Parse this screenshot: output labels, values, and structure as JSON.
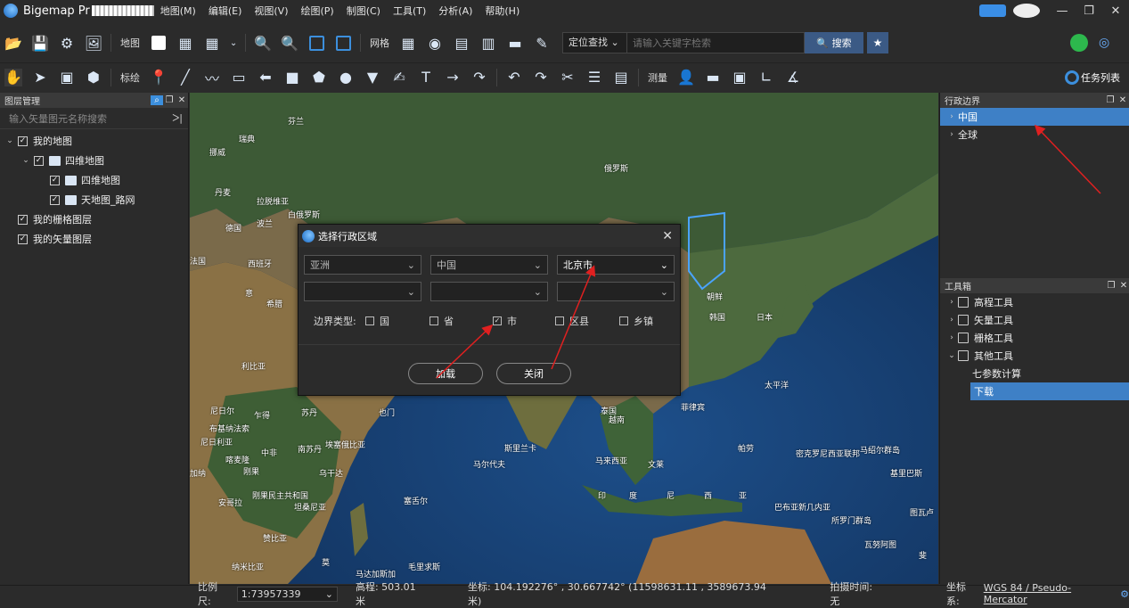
{
  "titlebar": {
    "app_name": "Bigemap Pr",
    "menus": [
      "地图(M)",
      "编辑(E)",
      "视图(V)",
      "绘图(P)",
      "制图(C)",
      "工具(T)",
      "分析(A)",
      "帮助(H)"
    ],
    "window_buttons": [
      "—",
      "❐",
      "✕"
    ]
  },
  "toolbar1": {
    "map_label": "地图",
    "grid_label": "网格",
    "locate_select": "定位查找",
    "search_placeholder": "请输入关键字检索",
    "search_button": "搜索"
  },
  "toolbar2": {
    "draw_label": "标绘",
    "measure_label": "测量",
    "tasklist_label": "任务列表"
  },
  "layer_panel": {
    "title": "图层管理",
    "search_placeholder": "输入矢量图元名称搜索",
    "tree": [
      {
        "label": "我的地图",
        "depth": 0,
        "chev": "⌄",
        "checked": true,
        "folder": false
      },
      {
        "label": "四维地图",
        "depth": 1,
        "chev": "⌄",
        "checked": true,
        "folder": true
      },
      {
        "label": "四维地图",
        "depth": 2,
        "chev": "",
        "checked": true,
        "folder": true
      },
      {
        "label": "天地图_路网",
        "depth": 2,
        "chev": "",
        "checked": true,
        "folder": true
      },
      {
        "label": "我的栅格图层",
        "depth": 0,
        "chev": "",
        "checked": true,
        "folder": false
      },
      {
        "label": "我的矢量图层",
        "depth": 0,
        "chev": "",
        "checked": true,
        "folder": false
      }
    ]
  },
  "admin_panel": {
    "title": "行政边界",
    "items": [
      {
        "label": "中国",
        "selected": true
      },
      {
        "label": "全球",
        "selected": false
      }
    ]
  },
  "toolbox_panel": {
    "title": "工具箱",
    "items": [
      {
        "label": "高程工具",
        "chev": "›",
        "indent": false,
        "selected": false
      },
      {
        "label": "矢量工具",
        "chev": "›",
        "indent": false,
        "selected": false
      },
      {
        "label": "栅格工具",
        "chev": "›",
        "indent": false,
        "selected": false
      },
      {
        "label": "其他工具",
        "chev": "⌄",
        "indent": false,
        "selected": false
      },
      {
        "label": "七参数计算",
        "chev": "",
        "indent": true,
        "selected": false
      },
      {
        "label": "下载",
        "chev": "",
        "indent": true,
        "selected": true
      }
    ]
  },
  "map_labels": [
    "芬兰",
    "瑞典",
    "挪威",
    "俄罗斯",
    "丹麦",
    "拉脱维亚",
    "波兰",
    "白俄罗斯",
    "德国",
    "法国",
    "西班牙",
    "意",
    "希腊",
    "利比亚",
    "尼日尔",
    "乍得",
    "苏丹",
    "也门",
    "尼日利亚",
    "中非",
    "南苏丹",
    "埃塞俄比亚",
    "刚果民主共和国",
    "安哥拉",
    "坦桑尼亚",
    "赞比亚",
    "纳米比亚",
    "莫",
    "马达加斯加",
    "毛里求斯",
    "塞舌尔",
    "马尔代夫",
    "斯里兰卡",
    "泰国",
    "越南",
    "菲律宾",
    "马来西亚",
    "印",
    "度",
    "尼",
    "西",
    "亚",
    "帕劳",
    "密克罗尼西亚联邦",
    "马绍尔群岛",
    "基里巴斯",
    "巴布亚新几内亚",
    "所罗门群岛",
    "图瓦卢",
    "瓦努阿图",
    "斐",
    "朝鲜",
    "韩国",
    "日本",
    "太平洋",
    "文莱",
    "加纳",
    "布基纳法索",
    "刚果",
    "乌干达",
    "喀麦隆"
  ],
  "dialog": {
    "title": "选择行政区域",
    "row1": [
      "亚洲",
      "中国",
      "北京市"
    ],
    "row2": [
      "",
      "",
      ""
    ],
    "boundary_label": "边界类型:",
    "boundary_types": [
      {
        "label": "国",
        "checked": false
      },
      {
        "label": "省",
        "checked": false
      },
      {
        "label": "市",
        "checked": true
      },
      {
        "label": "区县",
        "checked": false
      },
      {
        "label": "乡镇",
        "checked": false
      }
    ],
    "load_button": "加载",
    "close_button": "关闭"
  },
  "status": {
    "scale_label": "比例尺:",
    "scale_value": "1:73957339",
    "elevation": "高程:  503.01 米",
    "coords": "坐标:  104.192276° , 30.667742°   (11598631.11 , 3589673.94 米)",
    "capture_time": "拍摄时间:  无",
    "crs_label": "坐标系:",
    "crs_value": "WGS 84 / Pseudo-Mercator"
  },
  "colors": {
    "accent": "#3e80c6",
    "arrow": "#e02020",
    "background": "#2b2b2b"
  }
}
